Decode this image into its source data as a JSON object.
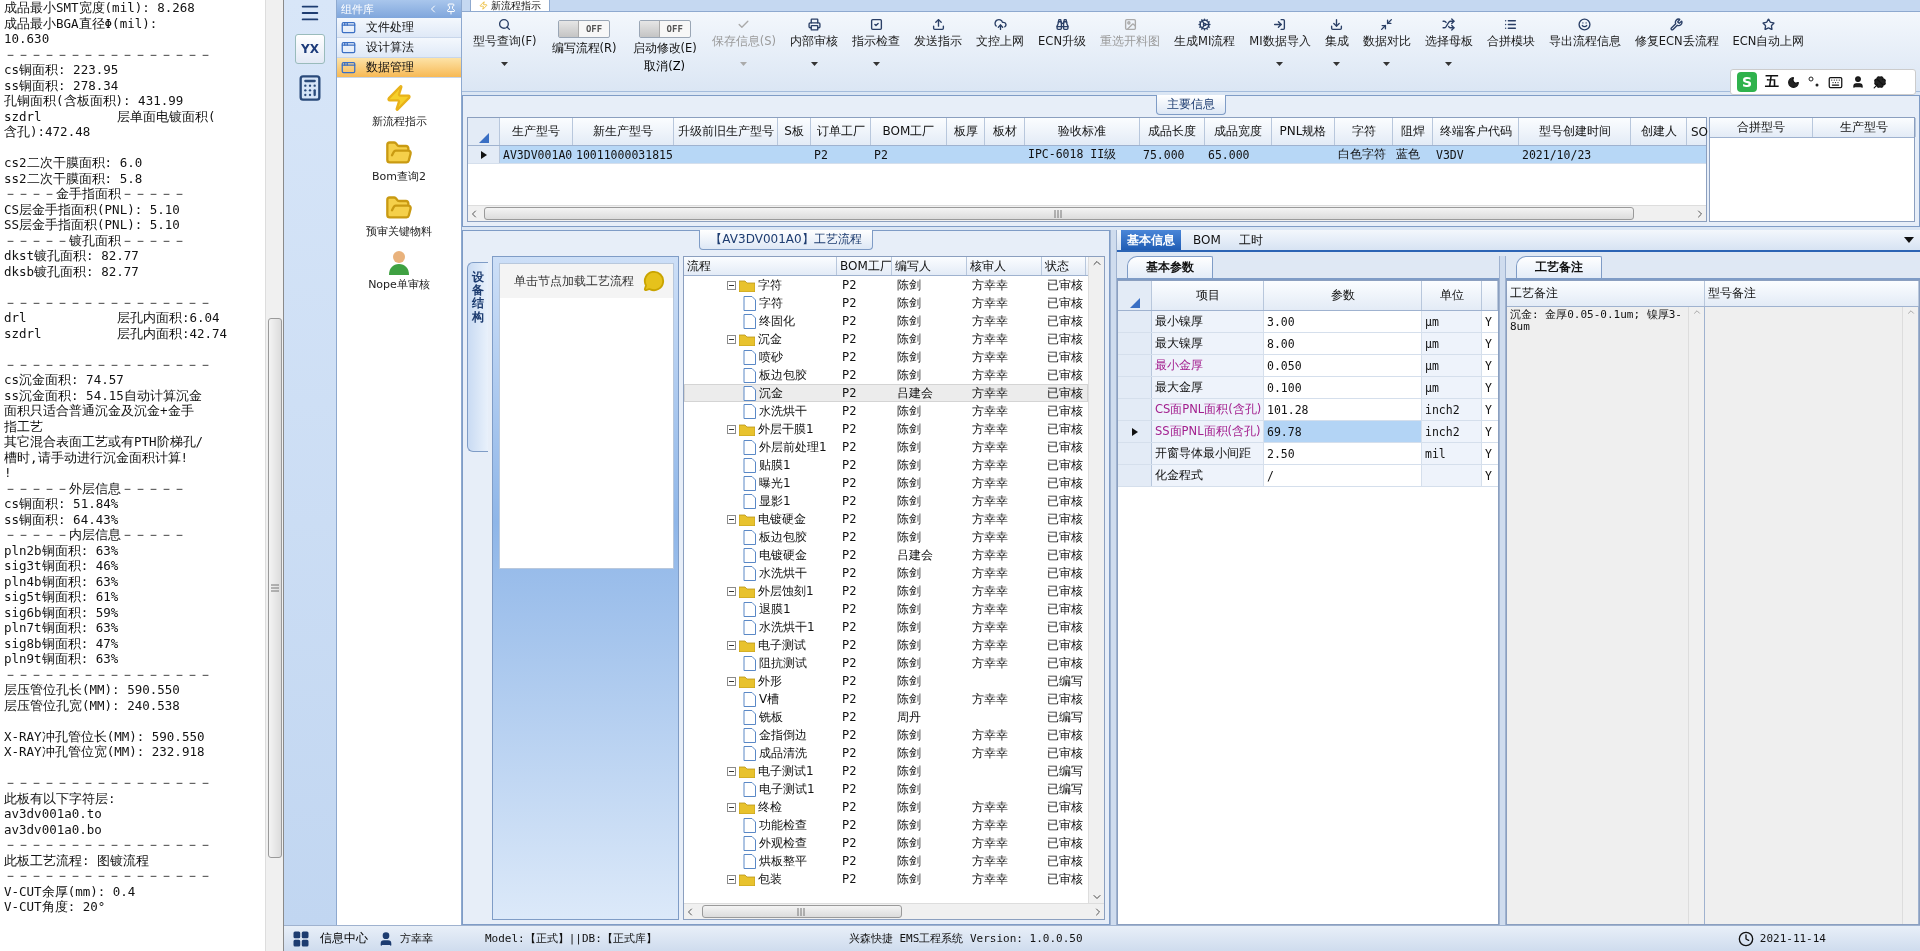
{
  "text_panel": {
    "blocks": [
      [
        "成品最小SMT宽度(mil): 8.268",
        "成品最小BGA直径Φ(mil):",
        "10.630",
        "－－－－－－－－－－－－－－－－",
        "cs铜面积: 223.95",
        "ss铜面积: 278.34",
        "孔铜面积(含板面积): 431.99",
        "szdrl          层单面电镀面积(",
        "含孔):472.48"
      ],
      [
        "cs2二次干膜面积: 6.0",
        "ss2二次干膜面积: 5.8",
        "－－－－金手指面积－－－－－",
        "CS层金手指面积(PNL): 5.10",
        "SS层金手指面积(PNL): 5.10",
        "－－－－－镀孔面积－－－－－",
        "dkst镀孔面积: 82.77",
        "dksb镀孔面积: 82.77"
      ],
      [
        "－－－－－－－－－－－－－－－－",
        "drl            层孔内面积:6.04",
        "szdrl          层孔内面积:42.74"
      ],
      [
        "－－－－－－－－－－－－－－－－",
        "cs沉金面积: 74.57",
        "ss沉金面积: 54.15自动计算沉金",
        "面积只适合普通沉金及沉金+金手",
        "指工艺",
        "其它混合表面工艺或有PTH阶梯孔/",
        "槽时,请手动进行沉金面积计算!",
        "!",
        "－－－－－外层信息－－－－－",
        "cs铜面积: 51.84%",
        "ss铜面积: 64.43%",
        "－－－－－内层信息－－－－－",
        "pln2b铜面积: 63%",
        "sig3t铜面积: 46%",
        "pln4b铜面积: 63%",
        "sig5t铜面积: 61%",
        "sig6b铜面积: 59%",
        "pln7t铜面积: 63%",
        "sig8b铜面积: 47%",
        "pln9t铜面积: 63%",
        "－－－－－－－－－－－－－－－－",
        "层压管位孔长(MM): 590.550",
        "层压管位孔宽(MM): 240.538"
      ],
      [
        "X-RAY冲孔管位长(MM): 590.550",
        "X-RAY冲孔管位宽(MM): 232.918"
      ],
      [
        "－－－－－－－－－－－－－－－－",
        "此板有以下字符层:",
        "av3dv001a0.to",
        "av3dv001a0.bo",
        "－－－－－－－－－－－－－－－－",
        "此板工艺流程: 图镀流程",
        "－－－－－－－－－－－－－－－－",
        "V-CUT余厚(mm): 0.4",
        "V-CUT角度: 20°"
      ]
    ]
  },
  "rail": {
    "logo": "YX"
  },
  "library": {
    "title": "组件库",
    "categories": [
      {
        "label": "文件处理",
        "selected": false
      },
      {
        "label": "设计算法",
        "selected": false
      },
      {
        "label": "数据管理",
        "selected": true
      }
    ],
    "tools": [
      {
        "label": "新流程指示",
        "kind": "bolt"
      },
      {
        "label": "Bom查询2",
        "kind": "folder"
      },
      {
        "label": "预审关键物料",
        "kind": "folder"
      },
      {
        "label": "Nope单审核",
        "kind": "user"
      }
    ]
  },
  "doc_tab": {
    "label": "新流程指示"
  },
  "toolbar": {
    "items": [
      {
        "kind": "button",
        "label": "型号查询(F)",
        "dropdown": true,
        "disabled": false
      },
      {
        "kind": "toggle",
        "label": "编写流程(R)",
        "switch_text": "OFF",
        "on": false
      },
      {
        "kind": "toggle",
        "label": "启动修改(E)",
        "switch_text": "OFF",
        "on": false,
        "sub_label": "取消(Z)"
      },
      {
        "kind": "button",
        "label": "保存信息(S)",
        "dropdown": true,
        "disabled": true
      },
      {
        "kind": "button",
        "label": "内部审核",
        "dropdown": true,
        "disabled": false
      },
      {
        "kind": "button",
        "label": "指示检查",
        "dropdown": true,
        "disabled": false
      },
      {
        "kind": "button",
        "label": "发送指示",
        "dropdown": false,
        "disabled": false
      },
      {
        "kind": "button",
        "label": "文控上网",
        "dropdown": false,
        "disabled": false
      },
      {
        "kind": "button",
        "label": "ECN升级",
        "dropdown": false,
        "disabled": false
      },
      {
        "kind": "button",
        "label": "重选开料图",
        "dropdown": false,
        "disabled": true
      },
      {
        "kind": "button",
        "label": "生成MI流程",
        "dropdown": false,
        "disabled": false
      },
      {
        "kind": "button",
        "label": "MI数据导入",
        "dropdown": true,
        "disabled": false
      },
      {
        "kind": "button",
        "label": "集成",
        "dropdown": true,
        "disabled": false
      },
      {
        "kind": "button",
        "label": "数据对比",
        "dropdown": true,
        "disabled": false
      },
      {
        "kind": "button",
        "label": "选择母板",
        "dropdown": true,
        "disabled": false
      },
      {
        "kind": "button",
        "label": "合拼模块",
        "dropdown": false,
        "disabled": false
      },
      {
        "kind": "button",
        "label": "导出流程信息",
        "dropdown": false,
        "disabled": false
      },
      {
        "kind": "button",
        "label": "修复ECN丢流程",
        "dropdown": false,
        "disabled": false
      },
      {
        "kind": "button",
        "label": "ECN自动上网",
        "dropdown": false,
        "disabled": false
      }
    ]
  },
  "ime": {
    "logo": "S",
    "mode": "五"
  },
  "main_info": {
    "title": "主要信息",
    "columns": [
      "生产型号",
      "新生产型号",
      "升级前旧生产型号",
      "S板",
      "订单工厂",
      "BOM工厂",
      "板厚",
      "板材",
      "验收标准",
      "成品长度",
      "成品宽度",
      "PNL规格",
      "字符",
      "阻焊",
      "终端客户代码",
      "型号创建时间",
      "创建人",
      "SO"
    ],
    "rows": [
      {
        "selected": true,
        "cells": [
          "AV3DV001A0",
          "10011000031815",
          null,
          null,
          "P2",
          "P2",
          null,
          null,
          "IPC-6018 II级",
          "75.000",
          "65.000",
          null,
          "白色字符",
          "蓝色",
          "V3DV",
          "2021/10/23",
          null,
          null
        ]
      }
    ],
    "side_columns": [
      "合拼型号",
      "生产型号"
    ]
  },
  "process": {
    "title": "【AV3DV001A0】工艺流程",
    "side_tab": "设备结构",
    "hint": "单击节点加载工艺流程",
    "columns": [
      "流程",
      "BOM工厂",
      "编写人",
      "核审人",
      "状态"
    ],
    "rows": [
      {
        "kind": "group",
        "name": "字符",
        "factory": "P2",
        "writer": "陈剑",
        "reviewer": "方幸幸",
        "status": "已审核",
        "expanded": true,
        "selected": false,
        "children": [
          {
            "kind": "step",
            "name": "字符",
            "factory": "P2",
            "writer": "陈剑",
            "reviewer": "方幸幸",
            "status": "已审核",
            "selected": false
          },
          {
            "kind": "step",
            "name": "终固化",
            "factory": "P2",
            "writer": "陈剑",
            "reviewer": "方幸幸",
            "status": "已审核",
            "selected": false
          }
        ]
      },
      {
        "kind": "group",
        "name": "沉金",
        "factory": "P2",
        "writer": "陈剑",
        "reviewer": "方幸幸",
        "status": "已审核",
        "expanded": true,
        "selected": false,
        "children": [
          {
            "kind": "step",
            "name": "喷砂",
            "factory": "P2",
            "writer": "陈剑",
            "reviewer": "方幸幸",
            "status": "已审核",
            "selected": false
          },
          {
            "kind": "step",
            "name": "板边包胶",
            "factory": "P2",
            "writer": "陈剑",
            "reviewer": "方幸幸",
            "status": "已审核",
            "selected": false
          },
          {
            "kind": "step",
            "name": "沉金",
            "factory": "P2",
            "writer": "吕建会",
            "reviewer": "方幸幸",
            "status": "已审核",
            "selected": true
          },
          {
            "kind": "step",
            "name": "水洗烘干",
            "factory": "P2",
            "writer": "陈剑",
            "reviewer": "方幸幸",
            "status": "已审核",
            "selected": false
          }
        ]
      },
      {
        "kind": "group",
        "name": "外层干膜1",
        "factory": "P2",
        "writer": "陈剑",
        "reviewer": "方幸幸",
        "status": "已审核",
        "expanded": true,
        "selected": false,
        "children": [
          {
            "kind": "step",
            "name": "外层前处理1",
            "factory": "P2",
            "writer": "陈剑",
            "reviewer": "方幸幸",
            "status": "已审核",
            "selected": false
          },
          {
            "kind": "step",
            "name": "贴膜1",
            "factory": "P2",
            "writer": "陈剑",
            "reviewer": "方幸幸",
            "status": "已审核",
            "selected": false
          },
          {
            "kind": "step",
            "name": "曝光1",
            "factory": "P2",
            "writer": "陈剑",
            "reviewer": "方幸幸",
            "status": "已审核",
            "selected": false
          },
          {
            "kind": "step",
            "name": "显影1",
            "factory": "P2",
            "writer": "陈剑",
            "reviewer": "方幸幸",
            "status": "已审核",
            "selected": false
          }
        ]
      },
      {
        "kind": "group",
        "name": "电镀硬金",
        "factory": "P2",
        "writer": "陈剑",
        "reviewer": "方幸幸",
        "status": "已审核",
        "expanded": true,
        "selected": false,
        "children": [
          {
            "kind": "step",
            "name": "板边包胶",
            "factory": "P2",
            "writer": "陈剑",
            "reviewer": "方幸幸",
            "status": "已审核",
            "selected": false
          },
          {
            "kind": "step",
            "name": "电镀硬金",
            "factory": "P2",
            "writer": "吕建会",
            "reviewer": "方幸幸",
            "status": "已审核",
            "selected": false
          },
          {
            "kind": "step",
            "name": "水洗烘干",
            "factory": "P2",
            "writer": "陈剑",
            "reviewer": "方幸幸",
            "status": "已审核",
            "selected": false
          }
        ]
      },
      {
        "kind": "group",
        "name": "外层蚀刻1",
        "factory": "P2",
        "writer": "陈剑",
        "reviewer": "方幸幸",
        "status": "已审核",
        "expanded": true,
        "selected": false,
        "children": [
          {
            "kind": "step",
            "name": "退膜1",
            "factory": "P2",
            "writer": "陈剑",
            "reviewer": "方幸幸",
            "status": "已审核",
            "selected": false
          },
          {
            "kind": "step",
            "name": "水洗烘干1",
            "factory": "P2",
            "writer": "陈剑",
            "reviewer": "方幸幸",
            "status": "已审核",
            "selected": false
          }
        ]
      },
      {
        "kind": "group",
        "name": "电子测试",
        "factory": "P2",
        "writer": "陈剑",
        "reviewer": "方幸幸",
        "status": "已审核",
        "expanded": true,
        "selected": false,
        "children": [
          {
            "kind": "step",
            "name": "阻抗测试",
            "factory": "P2",
            "writer": "陈剑",
            "reviewer": "方幸幸",
            "status": "已审核",
            "selected": false
          }
        ]
      },
      {
        "kind": "group",
        "name": "外形",
        "factory": "P2",
        "writer": "陈剑",
        "status": "已编写",
        "expanded": true,
        "selected": false,
        "children": [
          {
            "kind": "step",
            "name": "V槽",
            "factory": "P2",
            "writer": "陈剑",
            "reviewer": "方幸幸",
            "status": "已审核",
            "selected": false
          },
          {
            "kind": "step",
            "name": "铣板",
            "factory": "P2",
            "writer": "周丹",
            "status": "已编写",
            "selected": false
          },
          {
            "kind": "step",
            "name": "金指倒边",
            "factory": "P2",
            "writer": "陈剑",
            "reviewer": "方幸幸",
            "status": "已审核",
            "selected": false
          },
          {
            "kind": "step",
            "name": "成品清洗",
            "factory": "P2",
            "writer": "陈剑",
            "reviewer": "方幸幸",
            "status": "已审核",
            "selected": false
          }
        ]
      },
      {
        "kind": "group",
        "name": "电子测试1",
        "factory": "P2",
        "writer": "陈剑",
        "status": "已编写",
        "expanded": true,
        "selected": false,
        "children": [
          {
            "kind": "step",
            "name": "电子测试1",
            "factory": "P2",
            "writer": "陈剑",
            "status": "已编写",
            "selected": false
          }
        ]
      },
      {
        "kind": "group",
        "name": "终检",
        "factory": "P2",
        "writer": "陈剑",
        "reviewer": "方幸幸",
        "status": "已审核",
        "expanded": true,
        "selected": false,
        "children": [
          {
            "kind": "step",
            "name": "功能检查",
            "factory": "P2",
            "writer": "陈剑",
            "reviewer": "方幸幸",
            "status": "已审核",
            "selected": false
          },
          {
            "kind": "step",
            "name": "外观检查",
            "factory": "P2",
            "writer": "陈剑",
            "reviewer": "方幸幸",
            "status": "已审核",
            "selected": false
          },
          {
            "kind": "step",
            "name": "烘板整平",
            "factory": "P2",
            "writer": "陈剑",
            "reviewer": "方幸幸",
            "status": "已审核",
            "selected": false
          }
        ]
      },
      {
        "kind": "group",
        "name": "包装",
        "factory": "P2",
        "writer": "陈剑",
        "reviewer": "方幸幸",
        "status": "已审核",
        "expanded": true,
        "selected": false
      }
    ]
  },
  "detail_tabs": [
    {
      "label": "基本信息",
      "selected": true
    },
    {
      "label": "BOM",
      "selected": false
    },
    {
      "label": "工时",
      "selected": false
    }
  ],
  "params": {
    "tab": "基本参数",
    "columns": [
      "项目",
      "参数",
      "单位"
    ],
    "rows": [
      {
        "item": "最小镍厚",
        "value": "3.00",
        "unit": "μm",
        "column_4": "Y",
        "highlighted": false,
        "selected": false
      },
      {
        "item": "最大镍厚",
        "value": "8.00",
        "unit": "μm",
        "column_4": "Y",
        "highlighted": false,
        "selected": false
      },
      {
        "item": "最小金厚",
        "value": "0.050",
        "unit": "μm",
        "column_4": "Y",
        "highlighted": true,
        "selected": false
      },
      {
        "item": "最大金厚",
        "value": "0.100",
        "unit": "μm",
        "column_4": "Y",
        "highlighted": false,
        "selected": false
      },
      {
        "item": "CS面PNL面积(含孔)",
        "value": "101.28",
        "unit": "inch2",
        "column_4": "Y",
        "highlighted": true,
        "selected": false
      },
      {
        "item": "SS面PNL面积(含孔)",
        "value": "69.78",
        "unit": "inch2",
        "column_4": "Y",
        "highlighted": true,
        "selected": true
      },
      {
        "item": "开窗导体最小间距",
        "value": "2.50",
        "unit": "mil",
        "column_4": "Y",
        "highlighted": false,
        "selected": false
      },
      {
        "item": "化金程式",
        "value": "/",
        "column_4": "Y",
        "highlighted": false,
        "selected": false
      }
    ]
  },
  "notes": {
    "tab": "工艺备注",
    "columns": [
      "工艺备注",
      "型号备注"
    ],
    "process_note": "沉金: 金厚0.05-0.1um; 镍厚3-8um"
  },
  "status_bar": {
    "info_center": "信息中心",
    "user": "方幸幸",
    "model": "Model:【正式】||DB:【正式库】",
    "version": "兴森快捷 EMS工程系统 Version: 1.0.0.50",
    "date": "2021-11-14"
  }
}
